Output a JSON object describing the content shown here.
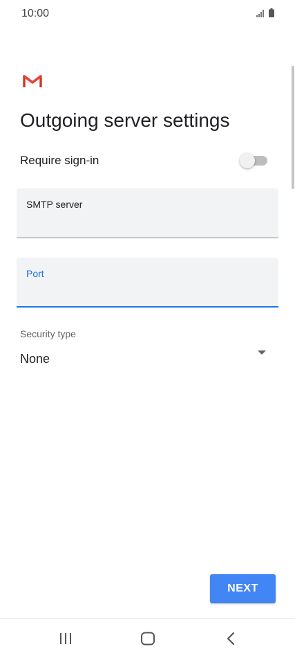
{
  "status_bar": {
    "time": "10:00",
    "icons": [
      "signal-icon",
      "battery-icon"
    ]
  },
  "app": {
    "logo": "gmail-logo"
  },
  "page": {
    "title": "Outgoing server settings"
  },
  "require_signin": {
    "label": "Require sign-in",
    "enabled": false
  },
  "smtp_field": {
    "label": "SMTP server",
    "value": ""
  },
  "port_field": {
    "label": "Port",
    "value": "",
    "focused": true
  },
  "security": {
    "label": "Security type",
    "value": "None"
  },
  "actions": {
    "next_label": "NEXT"
  },
  "nav_bar": {
    "icons": [
      "recents-icon",
      "home-icon",
      "back-icon"
    ]
  },
  "colors": {
    "accent": "#1a73e8",
    "button": "#4285f4",
    "field_background": "#f1f3f4",
    "gmail_red": "#d93025"
  }
}
